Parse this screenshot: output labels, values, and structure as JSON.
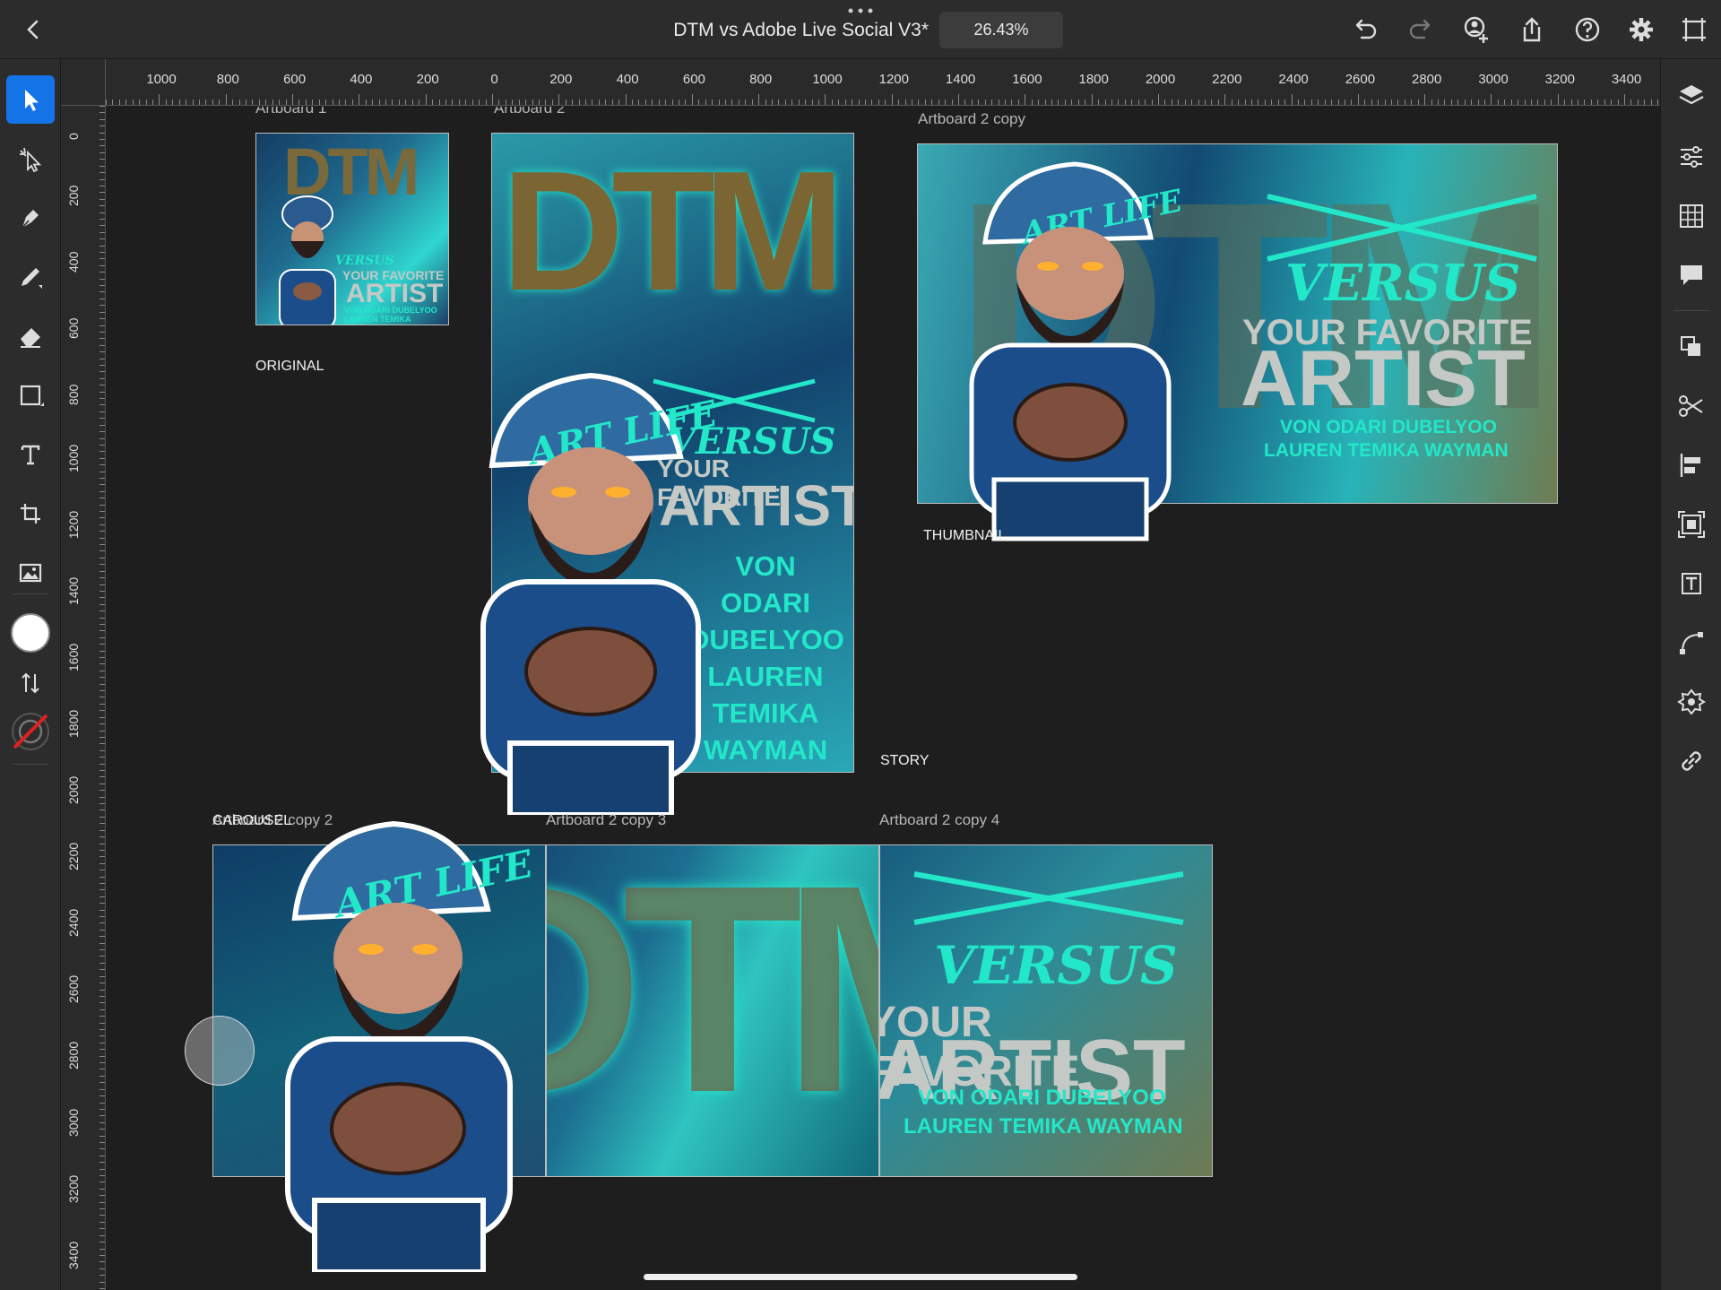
{
  "document": {
    "title": "DTM vs Adobe Live Social V3*",
    "zoom": "26.43%"
  },
  "ruler": {
    "horizontal": [
      "1000",
      "800",
      "600",
      "400",
      "200",
      "0",
      "200",
      "400",
      "600",
      "800",
      "1000",
      "1200",
      "1400",
      "1600",
      "1800",
      "2000",
      "2200",
      "2400",
      "2600",
      "2800",
      "3000",
      "3200",
      "3400"
    ],
    "vertical": [
      "0",
      "200",
      "400",
      "600",
      "800",
      "1000",
      "1200",
      "1400",
      "1600",
      "1800",
      "2000",
      "2200",
      "2400",
      "2600",
      "2800",
      "3000",
      "3200",
      "3400"
    ]
  },
  "artboards": {
    "ab1": {
      "name": "Artboard 1",
      "caption": "ORIGINAL"
    },
    "ab2": {
      "name": "Artboard 2",
      "caption": "STORY"
    },
    "ab2copy": {
      "name": "Artboard 2 copy",
      "caption": "THUMBNAIL"
    },
    "ab2copy2": {
      "name": "Artboard 2 copy 2",
      "caption": "CAROUSEL"
    },
    "ab2copy3": {
      "name": "Artboard 2 copy 3"
    },
    "ab2copy4": {
      "name": "Artboard 2 copy 4"
    }
  },
  "art": {
    "logo": "DTM",
    "cap_text": "ART LIFE",
    "versus": "VERSUS",
    "your_favorite": "YOUR FAVORITE",
    "artist": "ARTIST",
    "names_line1": "VON ODARI DUBELYOO",
    "names_line2": "LAUREN TEMIKA WAYMAN",
    "story_names": [
      "VON",
      "ODARI",
      "DUBELYOO",
      "LAUREN",
      "TEMIKA",
      "WAYMAN"
    ]
  },
  "colors": {
    "accent": "#1473e6",
    "cyan": "#23e7c9",
    "toolbar": "#2c2c2c",
    "canvas": "#1e1e1e"
  },
  "tools_left": [
    "select-tool",
    "direct-select-tool",
    "pen-tool",
    "pencil-tool",
    "eraser-tool",
    "rectangle-tool",
    "text-tool",
    "transform-tool",
    "image-tool",
    "fill-swatch",
    "swap-colors",
    "stroke-swatch"
  ],
  "tools_right": [
    "layers-icon",
    "properties-icon",
    "grid-icon",
    "comments-icon",
    "libraries-icon",
    "scissors-icon",
    "align-icon",
    "repeat-grid-icon",
    "type-icon",
    "path-icon",
    "symbols-icon",
    "link-icon"
  ]
}
